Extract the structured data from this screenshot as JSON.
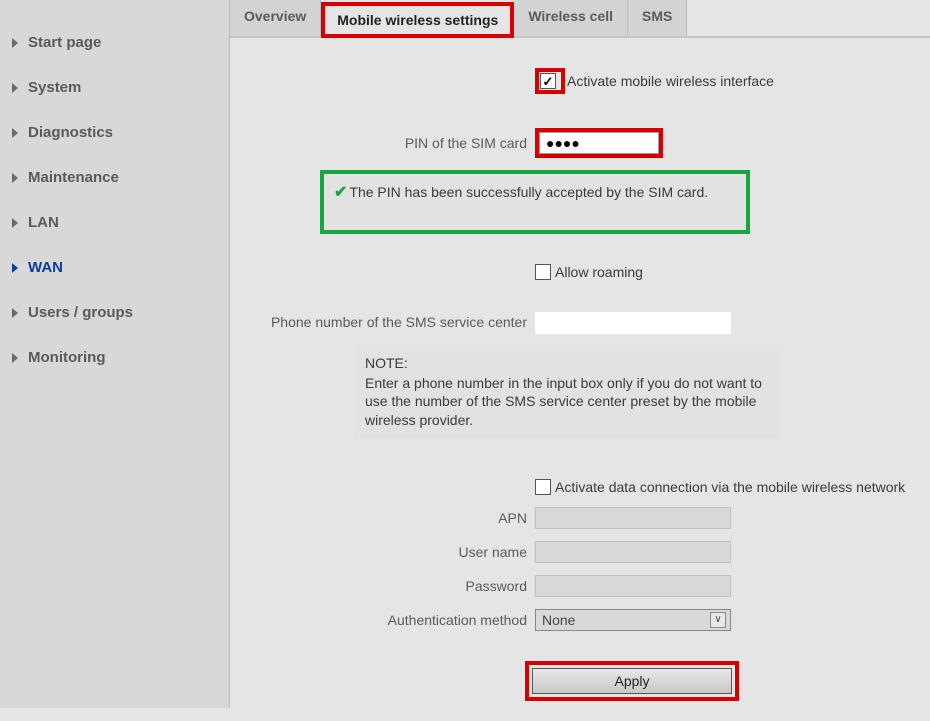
{
  "sidebar": {
    "items": [
      {
        "label": "Start page"
      },
      {
        "label": "System"
      },
      {
        "label": "Diagnostics"
      },
      {
        "label": "Maintenance"
      },
      {
        "label": "LAN"
      },
      {
        "label": "WAN"
      },
      {
        "label": "Users / groups"
      },
      {
        "label": "Monitoring"
      }
    ],
    "activeIndex": 5
  },
  "tabs": {
    "items": [
      {
        "label": "Overview"
      },
      {
        "label": "Mobile wireless settings"
      },
      {
        "label": "Wireless cell"
      },
      {
        "label": "SMS"
      }
    ],
    "activeIndex": 1
  },
  "form": {
    "activate_label": "Activate mobile wireless interface",
    "activate_checked": true,
    "pin_label": "PIN of the SIM card",
    "pin_value": "●●●●",
    "pin_status": "The PIN has been successfully accepted by the SIM card.",
    "roaming_label": "Allow roaming",
    "roaming_checked": false,
    "sms_center_label": "Phone number of the SMS service center",
    "sms_center_value": "",
    "note_title": "NOTE:",
    "note_body": "Enter a phone number in the input box only if you do not want to use the number of the SMS service center preset by the mobile wireless provider.",
    "activate_data_label": "Activate data connection via the mobile wireless network",
    "activate_data_checked": false,
    "apn_label": "APN",
    "apn_value": "",
    "username_label": "User name",
    "username_value": "",
    "password_label": "Password",
    "password_value": "",
    "auth_label": "Authentication method",
    "auth_value": "None",
    "apply_label": "Apply"
  }
}
